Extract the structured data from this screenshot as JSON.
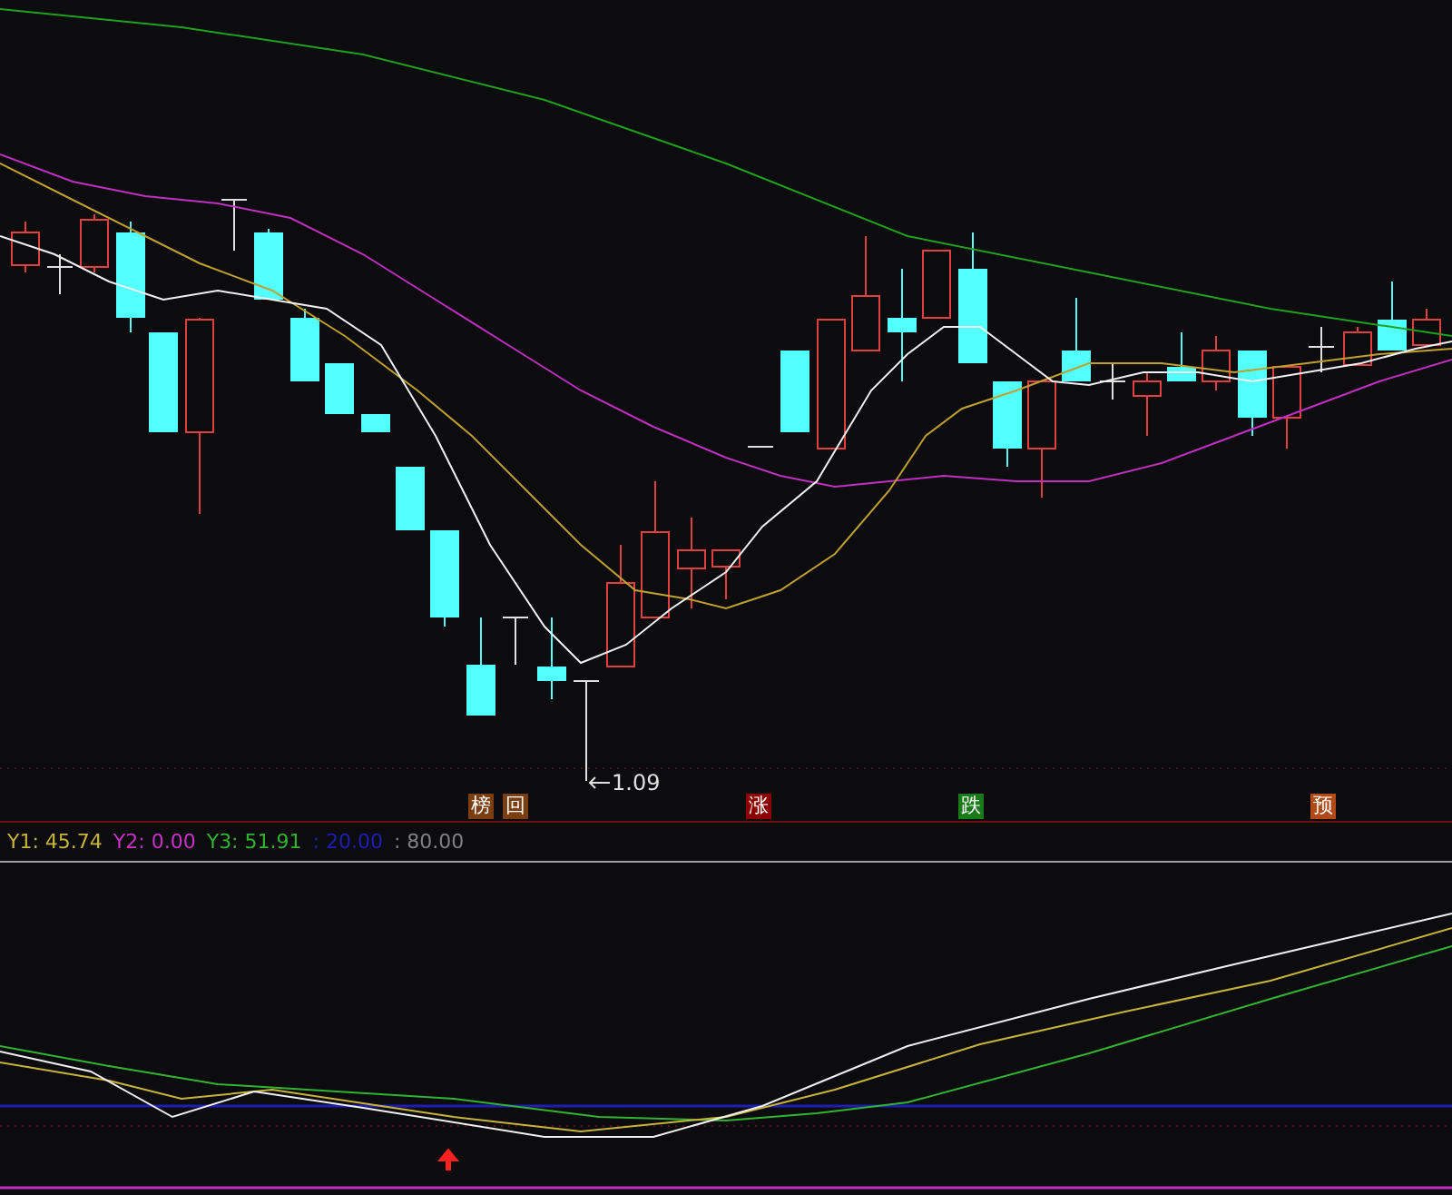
{
  "main_chart": {
    "low_label": "1.09",
    "signals": [
      {
        "label": "榜",
        "color": "#7a3e10"
      },
      {
        "label": "回",
        "color": "#7a3e10"
      },
      {
        "label": "涨",
        "color": "#8b0000"
      },
      {
        "label": "跌",
        "color": "#1a7a1a"
      },
      {
        "label": "预",
        "color": "#b04a18"
      }
    ]
  },
  "indicator_legend": [
    {
      "label": "Y1: 45.74",
      "color": "#c8b43c"
    },
    {
      "label": "Y2: 0.00",
      "color": "#c832c8"
    },
    {
      "label": "Y3: 51.91",
      "color": "#32b432"
    },
    {
      "label": ": 20.00",
      "color": "#1e1eb4"
    },
    {
      "label": ": 80.00",
      "color": "#808080"
    }
  ]
}
